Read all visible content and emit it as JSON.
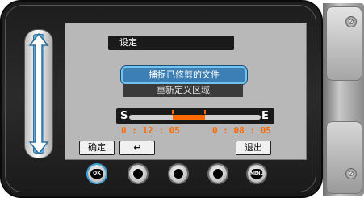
{
  "menu": {
    "title": "设定",
    "options": [
      "捕捉已修剪的文件",
      "重新定义区域"
    ],
    "selected_index": 0
  },
  "trim": {
    "start_label": "S",
    "end_label": "E",
    "start_time": "0 : 12 : 05",
    "end_time": "0 : 08 : 05"
  },
  "softkeys": {
    "confirm": "确定",
    "back": "↩",
    "exit": "退出"
  },
  "buttons": {
    "ok": "OK",
    "menu": "MENU"
  },
  "colors": {
    "accent": "#3b7fb4",
    "highlight_border": "#73c3f0",
    "time_color": "#ff6a00",
    "slider_track": "#6aa9d6"
  }
}
